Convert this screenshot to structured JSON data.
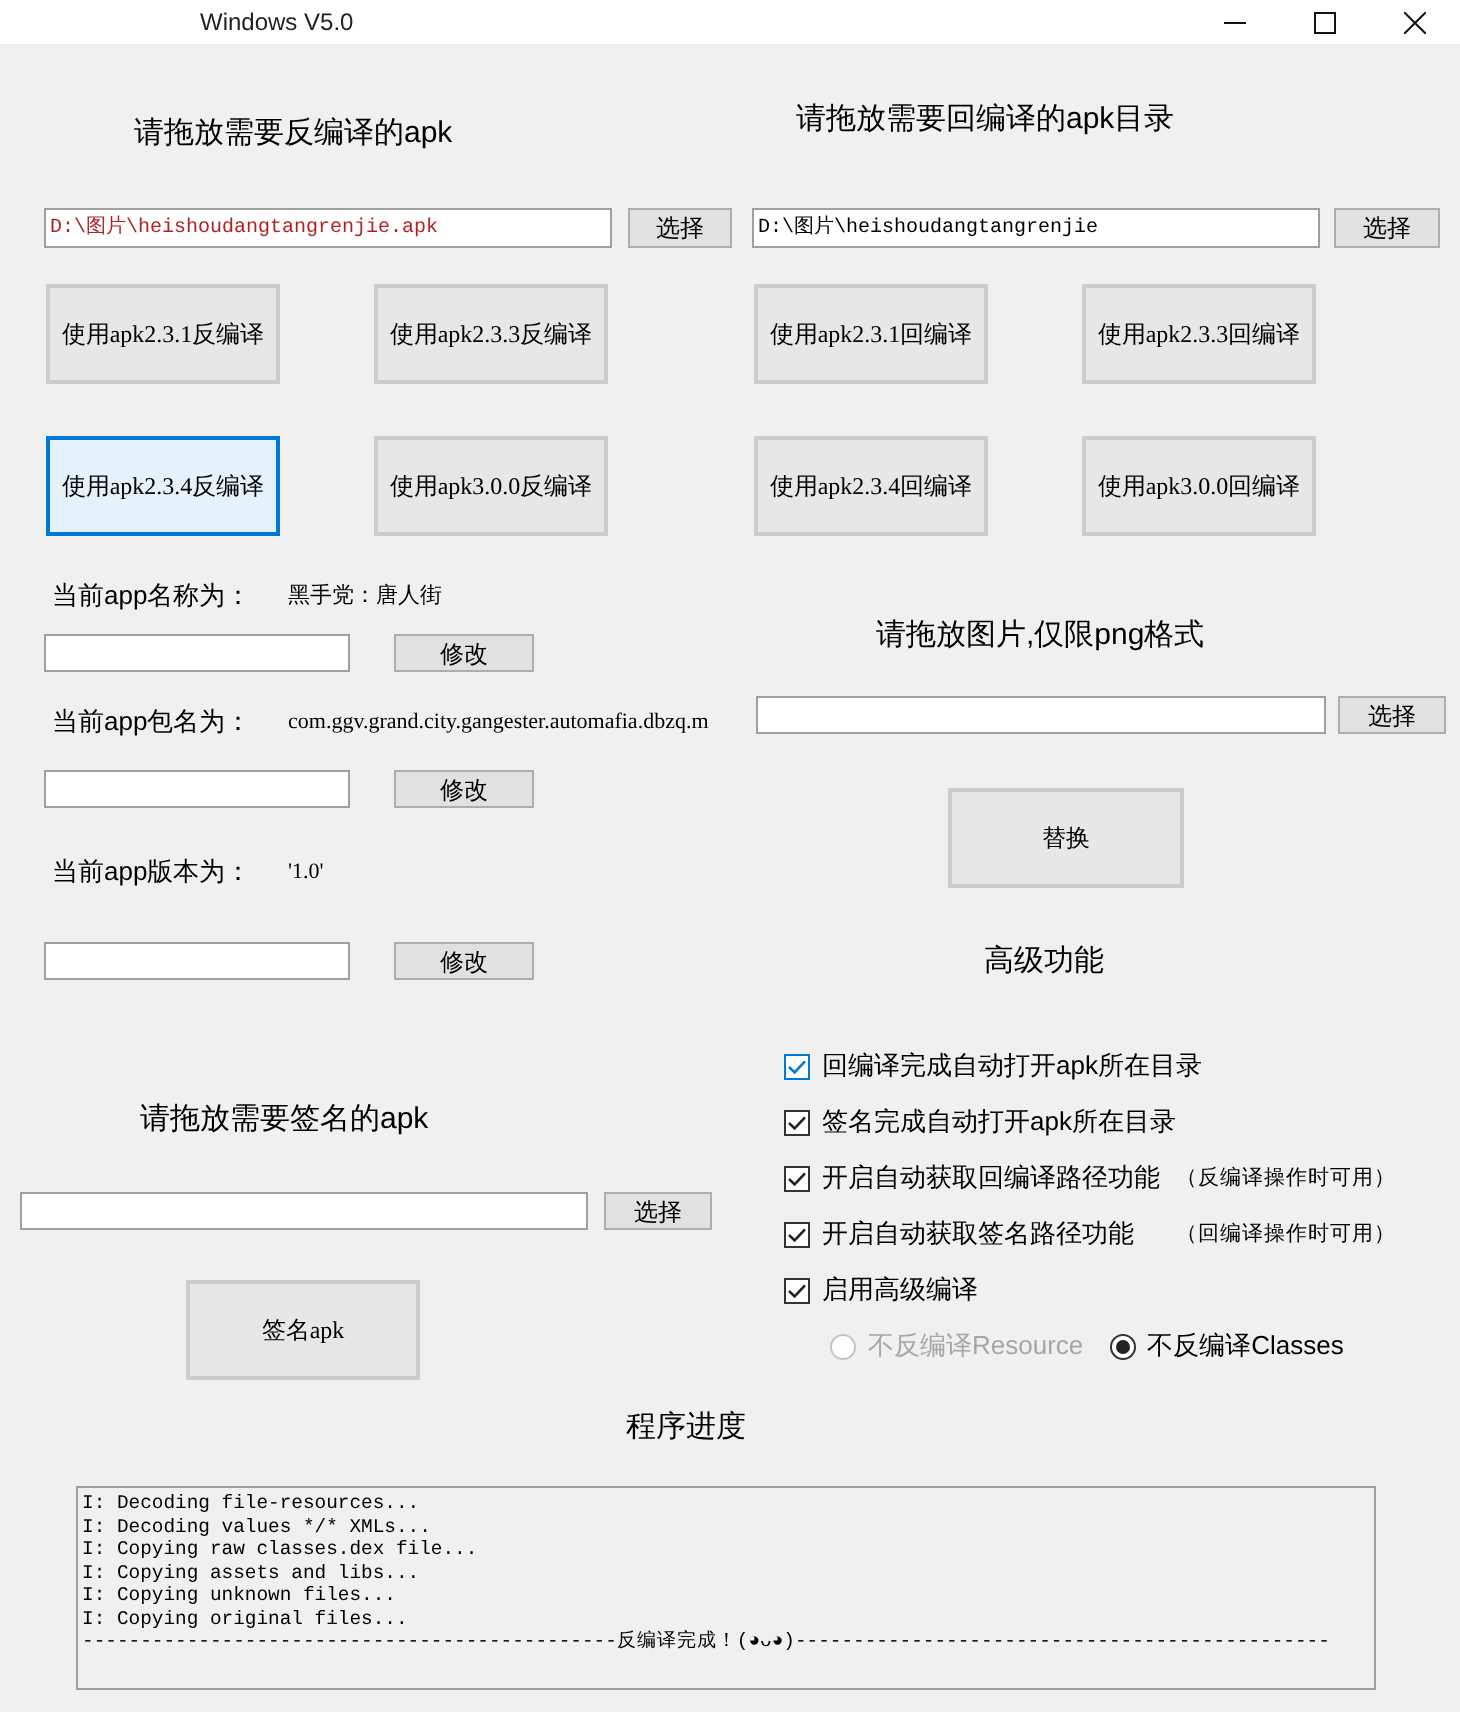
{
  "window": {
    "title": "Windows V5.0"
  },
  "decompile": {
    "heading": "请拖放需要反编译的apk",
    "field": {
      "value": "D:\\图片\\heishoudangtangrenjie.apk",
      "color": "#b22222"
    },
    "browse_button": "选择",
    "buttons": [
      {
        "label": "使用apk2.3.1反编译",
        "focused": false
      },
      {
        "label": "使用apk2.3.3反编译",
        "focused": false
      },
      {
        "label": "使用apk2.3.4反编译",
        "focused": true
      },
      {
        "label": "使用apk3.0.0反编译",
        "focused": false
      }
    ]
  },
  "recompile": {
    "heading": "请拖放需要回编译的apk目录",
    "field": {
      "value": "D:\\图片\\heishoudangtangrenjie",
      "color": "#000000"
    },
    "browse_button": "选择",
    "buttons": [
      {
        "label": "使用apk2.3.1回编译",
        "focused": false
      },
      {
        "label": "使用apk2.3.3回编译",
        "focused": false
      },
      {
        "label": "使用apk2.3.4回编译",
        "focused": false
      },
      {
        "label": "使用apk3.0.0回编译",
        "focused": false
      }
    ]
  },
  "app_info": [
    {
      "label": "当前app名称为：",
      "value": "黑手党：唐人街",
      "button": "修改"
    },
    {
      "label": "当前app包名为：",
      "value": "com.ggv.grand.city.gangester.automafia.dbzq.m",
      "button": "修改"
    },
    {
      "label": "当前app版本为：",
      "value": "'1.0'",
      "button": "修改"
    }
  ],
  "icon_replace": {
    "heading": "请拖放图片,仅限png格式",
    "browse_button": "选择",
    "replace_button": "替换"
  },
  "advanced": {
    "heading": "高级功能",
    "options": [
      {
        "label": "回编译完成自动打开apk所在目录",
        "checked": true,
        "focused": true
      },
      {
        "label": "签名完成自动打开apk所在目录",
        "checked": true,
        "focused": false
      },
      {
        "label": "开启自动获取回编译路径功能",
        "note": "（反编译操作时可用）",
        "checked": true,
        "focused": false
      },
      {
        "label": "开启自动获取签名路径功能",
        "note": "（回编译操作时可用）",
        "checked": true,
        "focused": false
      },
      {
        "label": "启用高级编译",
        "checked": true,
        "focused": false
      }
    ],
    "radios": [
      {
        "label": "不反编译Resource",
        "selected": false,
        "disabled": true
      },
      {
        "label": "不反编译Classes",
        "selected": true,
        "disabled": false
      }
    ]
  },
  "sign": {
    "heading": "请拖放需要签名的apk",
    "browse_button": "选择",
    "sign_button": "签名apk"
  },
  "progress": {
    "heading": "程序进度",
    "log": [
      "I: Decoding file-resources...",
      "I: Decoding values */* XMLs...",
      "I: Copying raw classes.dex file...",
      "I: Copying assets and libs...",
      "I: Copying unknown files...",
      "I: Copying original files...",
      "----------------------------------------------反编译完成！(◕ᴗ◕)----------------------------------------------"
    ]
  }
}
